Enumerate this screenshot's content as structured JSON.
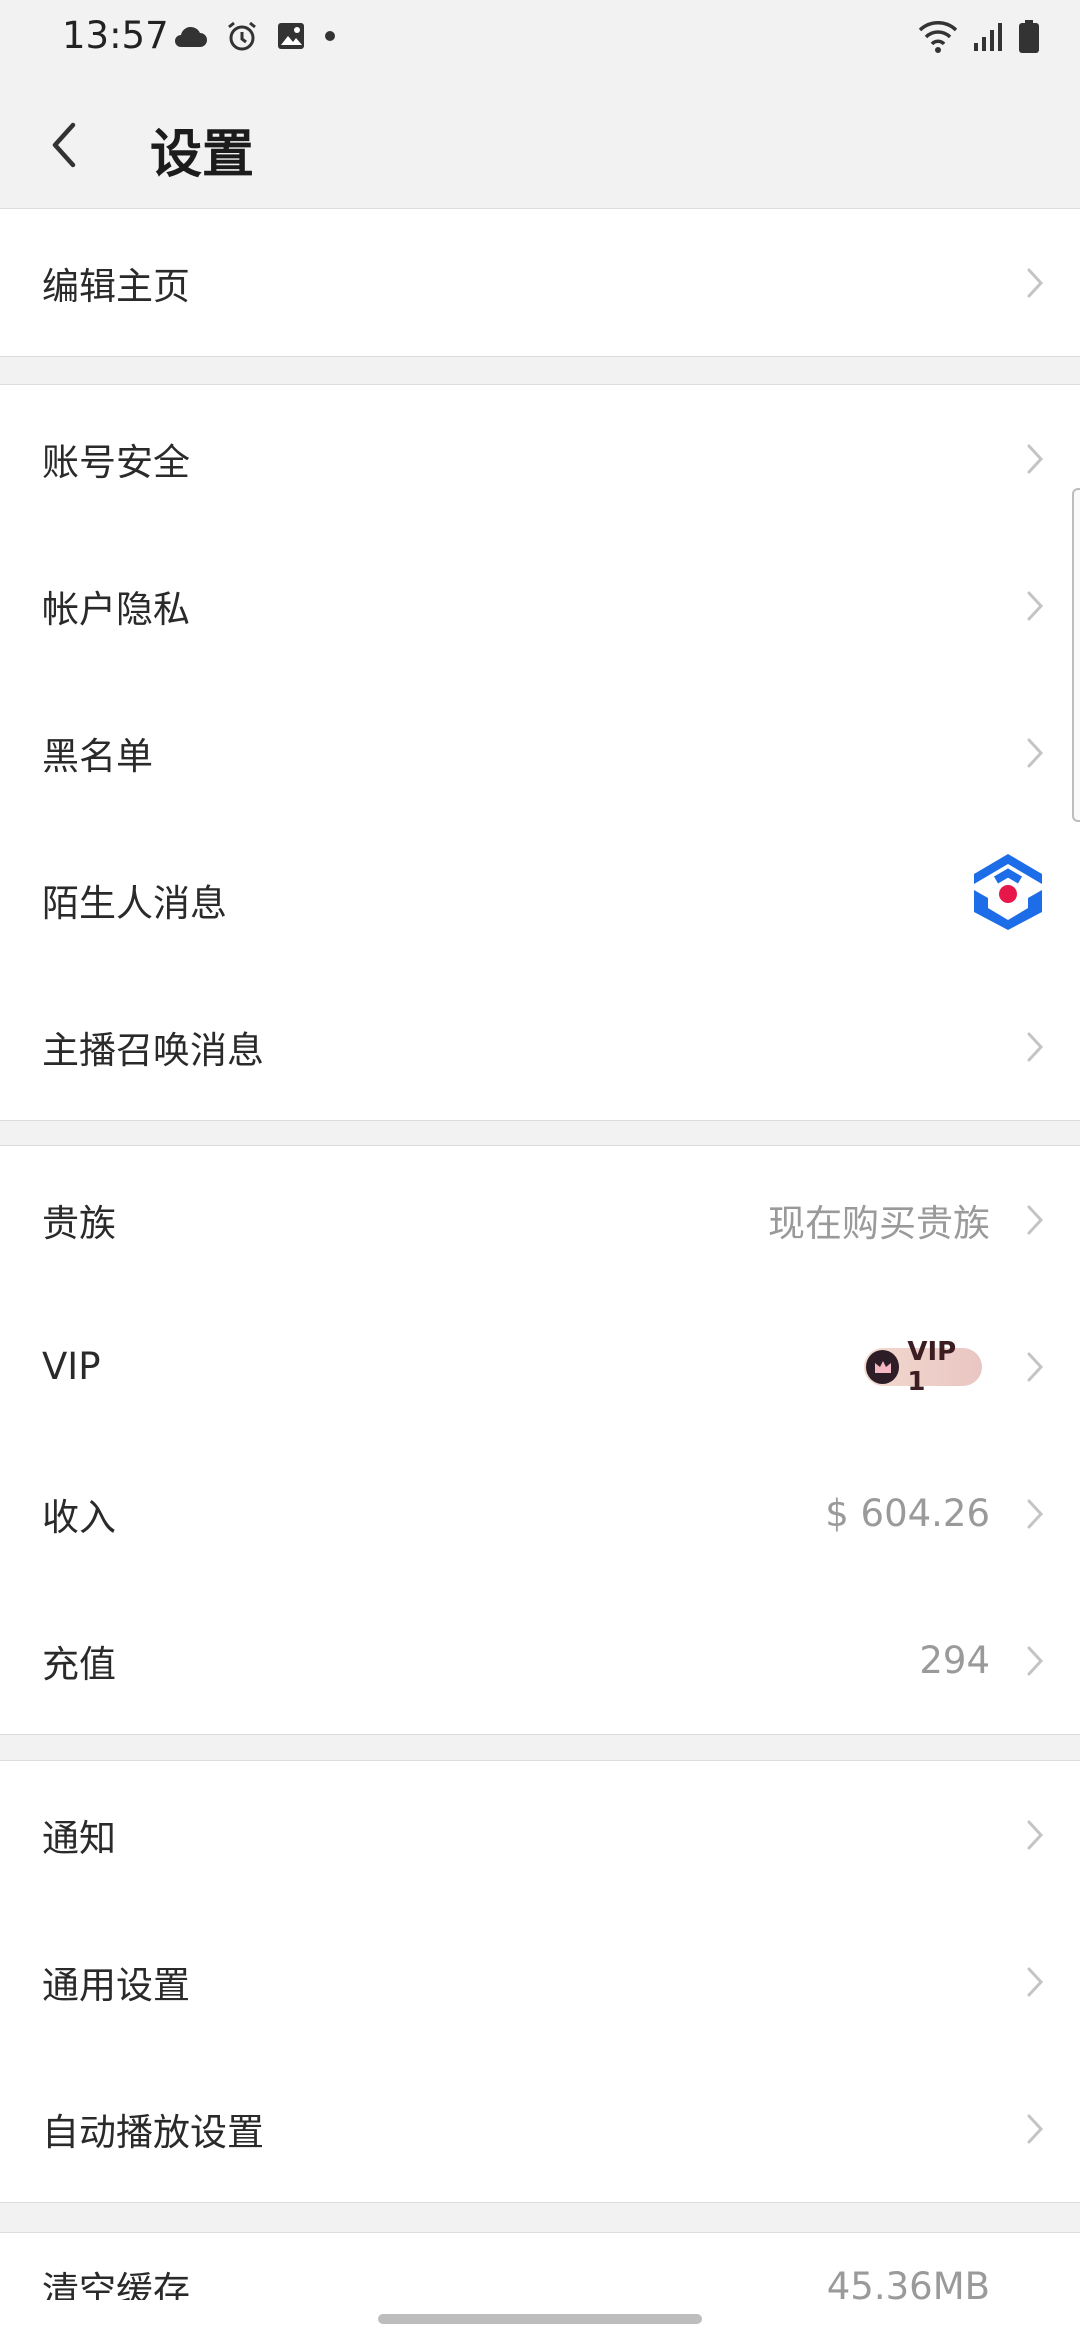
{
  "status_bar": {
    "time": "13:57",
    "left_icons": [
      "cloud-icon",
      "alarm-icon",
      "image-icon",
      "dot-icon"
    ],
    "right_icons": [
      "wifi-icon",
      "signal-icon",
      "battery-icon"
    ]
  },
  "header": {
    "title": "设置"
  },
  "sections": [
    {
      "rows": [
        {
          "label": "编辑主页"
        }
      ]
    },
    {
      "rows": [
        {
          "label": "账号安全"
        },
        {
          "label": "帐户隐私"
        },
        {
          "label": "黑名单"
        },
        {
          "label": "陌生人消息"
        },
        {
          "label": "主播召唤消息"
        }
      ]
    },
    {
      "rows": [
        {
          "label": "贵族",
          "value": "现在购买贵族"
        },
        {
          "label": "VIP",
          "badge": "VIP 1"
        },
        {
          "label": "收入",
          "value": "$ 604.26"
        },
        {
          "label": "充值",
          "value": "294"
        }
      ]
    },
    {
      "rows": [
        {
          "label": "通知"
        },
        {
          "label": "通用设置"
        },
        {
          "label": "自动播放设置"
        }
      ]
    },
    {
      "rows": [
        {
          "label": "清空缓存",
          "value": "45.36MB"
        }
      ]
    }
  ],
  "colors": {
    "background": "#f2f2f2",
    "row_bg": "#ffffff",
    "value_text": "#9a9a9a",
    "logo_blue": "#1e6de8",
    "logo_red": "#e8174a"
  }
}
